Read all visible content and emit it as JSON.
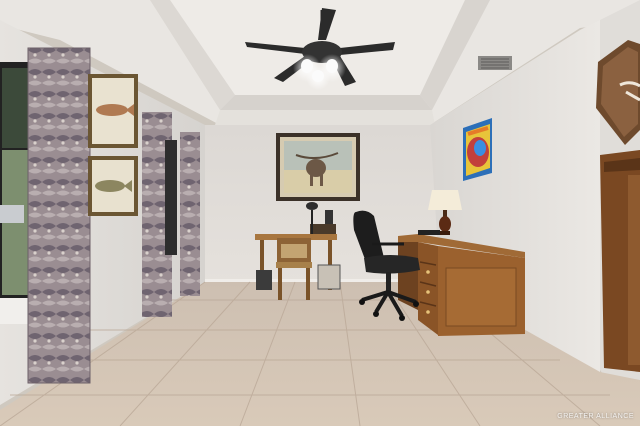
{
  "photo": {
    "subject": "Home office room with ceiling fan, desks, office chair, framed wall art and tiled floor",
    "watermark": "GREATER ALLIANCE"
  },
  "colors": {
    "wall": "#e3e0dc",
    "ceiling": "#ece9e5",
    "floor_tile": "#d8cbbb",
    "wood": "#8a5427",
    "curtain": "#8d7f86"
  }
}
